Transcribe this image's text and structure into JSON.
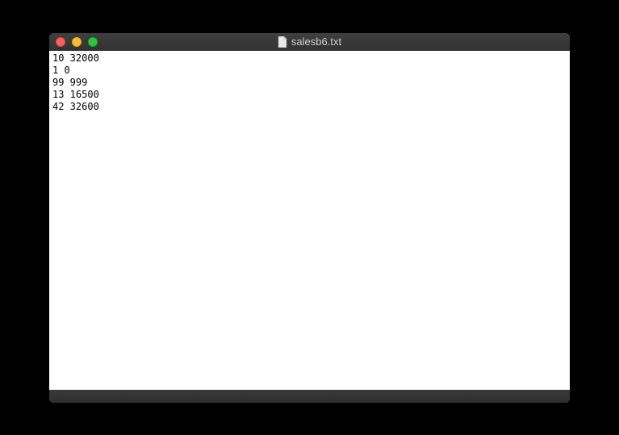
{
  "window": {
    "title": "salesb6.txt",
    "file_icon": "document-icon"
  },
  "content": {
    "lines": [
      "10 32000",
      "1 0",
      "99 999",
      "13 16500",
      "42 32600"
    ]
  }
}
